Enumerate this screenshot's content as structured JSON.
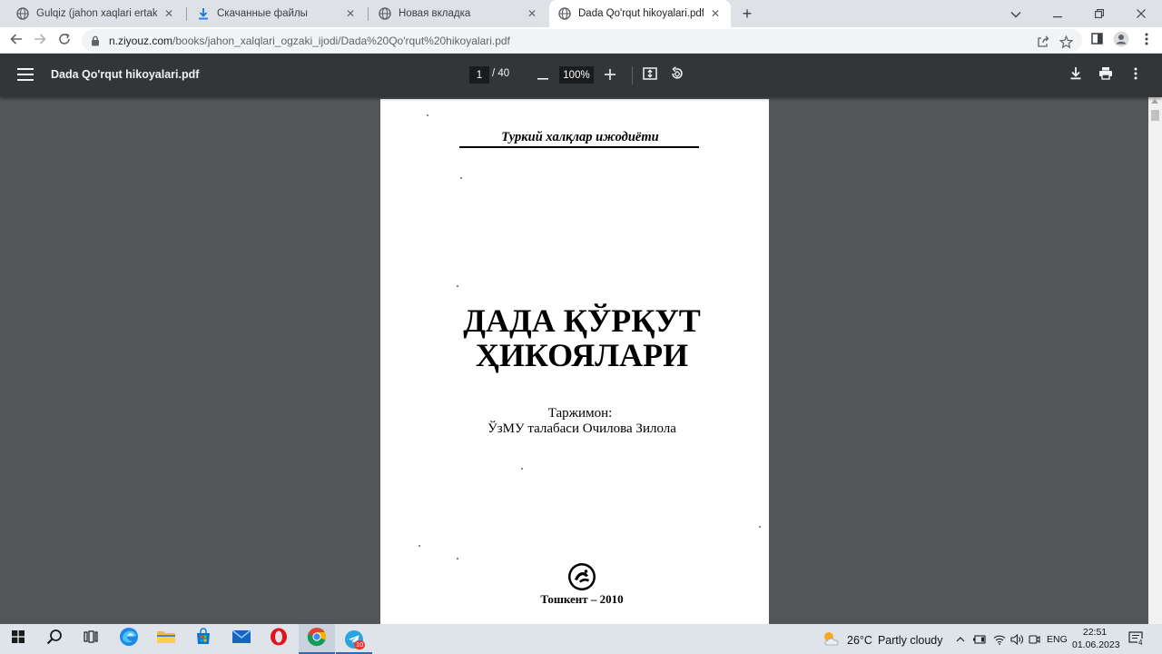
{
  "browser": {
    "tabs": [
      {
        "title": "Gulqiz (jahon xaqlari ertaklari).pd",
        "favicon": "globe-icon",
        "active": false
      },
      {
        "title": "Скачанные файлы",
        "favicon": "download-icon",
        "active": false
      },
      {
        "title": "Новая вкладка",
        "favicon": "globe-icon",
        "active": false
      },
      {
        "title": "Dada Qo'rqut hikoyalari.pdf",
        "favicon": "globe-icon",
        "active": true
      }
    ],
    "new_tab_label": "+",
    "address": {
      "host": "n.ziyouz.com",
      "path": "/books/jahon_xalqlari_ogzaki_ijodi/Dada%20Qo'rqut%20hikoyalari.pdf"
    }
  },
  "pdf_viewer": {
    "file_title": "Dada Qo'rqut hikoyalari.pdf",
    "current_page": "1",
    "total_pages": "/ 40",
    "zoom": "100%"
  },
  "document": {
    "series": "Туркий халқлар ижодиёти",
    "title_line1": "ДАДА ҚЎРҚУТ",
    "title_line2": "ҲИКОЯЛАРИ",
    "translator_label": "Таржимон:",
    "translator_name": "ЎзМУ талабаси Очилова Зилола",
    "imprint": "Тошкент – 2010"
  },
  "taskbar": {
    "apps": [
      "windows-start",
      "search",
      "task-view",
      "edge",
      "file-explorer",
      "microsoft-store",
      "mail",
      "opera",
      "chrome",
      "telegram"
    ],
    "telegram_badge": "10",
    "weather": {
      "temp": "26°C",
      "condition": "Partly cloudy"
    },
    "language": "ENG",
    "time": "22:51",
    "date": "01.06.2023",
    "notification_count": "4"
  }
}
